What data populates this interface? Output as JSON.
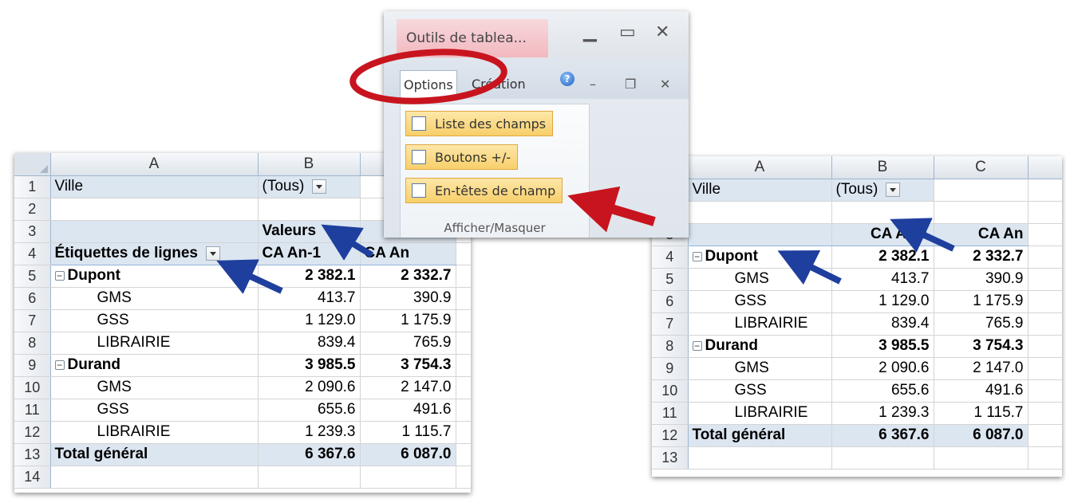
{
  "left_sheet": {
    "columns": [
      "A",
      "B"
    ],
    "filter": {
      "label": "Ville",
      "value": "(Tous)"
    },
    "values_header": "Valeurs",
    "row_labels_header": "Étiquettes de lignes",
    "value_cols": [
      "CA An-1",
      "CA An"
    ],
    "groups": [
      {
        "name": "Dupont",
        "v1": "2 382.1",
        "v2": "2 332.7",
        "items": [
          {
            "name": "GMS",
            "v1": "413.7",
            "v2": "390.9"
          },
          {
            "name": "GSS",
            "v1": "1 129.0",
            "v2": "1 175.9"
          },
          {
            "name": "LIBRAIRIE",
            "v1": "839.4",
            "v2": "765.9"
          }
        ]
      },
      {
        "name": "Durand",
        "v1": "3 985.5",
        "v2": "3 754.3",
        "items": [
          {
            "name": "GMS",
            "v1": "2 090.6",
            "v2": "2 147.0"
          },
          {
            "name": "GSS",
            "v1": "655.6",
            "v2": "491.6"
          },
          {
            "name": "LIBRAIRIE",
            "v1": "1 239.3",
            "v2": "1 115.7"
          }
        ]
      }
    ],
    "total": {
      "label": "Total général",
      "v1": "6 367.6",
      "v2": "6 087.0"
    },
    "row_numbers": [
      "1",
      "2",
      "3",
      "4",
      "5",
      "6",
      "7",
      "8",
      "9",
      "10",
      "11",
      "12",
      "13",
      "14"
    ]
  },
  "right_sheet": {
    "columns": [
      "A",
      "B",
      "C"
    ],
    "filter": {
      "label": "Ville",
      "value": "(Tous)"
    },
    "value_cols": [
      "CA An-1",
      "CA An"
    ],
    "groups": [
      {
        "name": "Dupont",
        "v1": "2 382.1",
        "v2": "2 332.7",
        "items": [
          {
            "name": "GMS",
            "v1": "413.7",
            "v2": "390.9"
          },
          {
            "name": "GSS",
            "v1": "1 129.0",
            "v2": "1 175.9"
          },
          {
            "name": "LIBRAIRIE",
            "v1": "839.4",
            "v2": "765.9"
          }
        ]
      },
      {
        "name": "Durand",
        "v1": "3 985.5",
        "v2": "3 754.3",
        "items": [
          {
            "name": "GMS",
            "v1": "2 090.6",
            "v2": "2 147.0"
          },
          {
            "name": "GSS",
            "v1": "655.6",
            "v2": "491.6"
          },
          {
            "name": "LIBRAIRIE",
            "v1": "1 239.3",
            "v2": "1 115.7"
          }
        ]
      }
    ],
    "total": {
      "label": "Total général",
      "v1": "6 367.6",
      "v2": "6 087.0"
    },
    "row_numbers": [
      "3",
      "4",
      "5",
      "6",
      "7",
      "8",
      "9",
      "10",
      "11",
      "12",
      "13"
    ]
  },
  "ribbon": {
    "context_title": "Outils de tablea...",
    "tabs": [
      "Options",
      "Création"
    ],
    "buttons": [
      "Liste des champs",
      "Boutons +/-",
      "En-têtes de champ"
    ],
    "group_label": "Afficher/Masquer"
  },
  "colors": {
    "arrow_blue": "#1f3f9e",
    "arrow_red": "#c8141e",
    "highlight_circle": "#c8141e",
    "pivot_band": "#dce6f1"
  }
}
